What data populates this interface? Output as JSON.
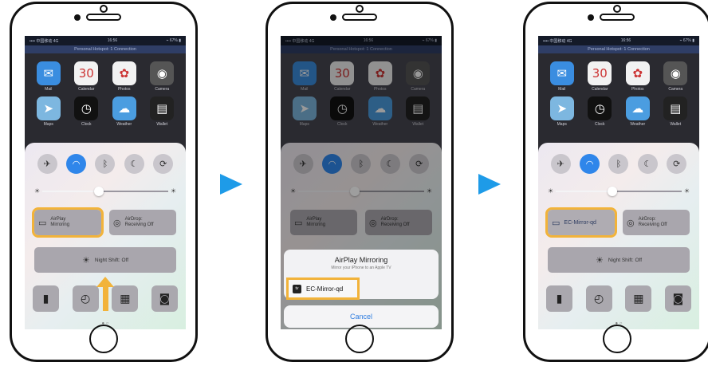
{
  "colors": {
    "highlight": "#f2b33a",
    "arrow": "#1e9be8",
    "toggle_on": "#2f86ea",
    "cancel_text": "#2f7de0"
  },
  "status_bar": {
    "left": "•••• 中国移动  4G",
    "time": "16:56",
    "right": "⌁ 67% ▮"
  },
  "banner": "Personal Hotspot: 1 Connection",
  "apps": [
    {
      "label": "Mail",
      "icon": "mail-icon",
      "glyph": "✉",
      "color": "#3a8de0"
    },
    {
      "label": "Calendar",
      "icon": "calendar-icon",
      "glyph": "30",
      "color": "#f2f2f2"
    },
    {
      "label": "Photos",
      "icon": "photos-icon",
      "glyph": "✿",
      "color": "#f2f2f2"
    },
    {
      "label": "Camera",
      "icon": "camera-icon",
      "glyph": "◉",
      "color": "#555"
    },
    {
      "label": "Maps",
      "icon": "maps-icon",
      "glyph": "➤",
      "color": "#7db7e0"
    },
    {
      "label": "Clock",
      "icon": "clock-icon",
      "glyph": "◷",
      "color": "#111"
    },
    {
      "label": "Weather",
      "icon": "weather-icon",
      "glyph": "☁",
      "color": "#4b9de0"
    },
    {
      "label": "Wallet",
      "icon": "wallet-icon",
      "glyph": "▤",
      "color": "#222"
    }
  ],
  "control_center": {
    "toggles": [
      {
        "icon": "airplane-icon",
        "glyph": "✈",
        "on": false
      },
      {
        "icon": "wifi-icon",
        "glyph": "◠",
        "on": true
      },
      {
        "icon": "bluetooth-icon",
        "glyph": "ᛒ",
        "on": false
      },
      {
        "icon": "moon-icon",
        "glyph": "☾",
        "on": false
      },
      {
        "icon": "rotation-lock-icon",
        "glyph": "⟳",
        "on": false
      }
    ],
    "brightness": 0.45,
    "airplay_label_line1": "AirPlay",
    "airplay_label_line2": "Mirroring",
    "airdrop_label_line1": "AirDrop:",
    "airdrop_label_line2": "Receiving Off",
    "airplay_selected_label": "EC-Mirror-qd",
    "night_shift_label": "Night Shift: Off",
    "shortcuts": [
      {
        "icon": "flashlight-icon",
        "glyph": "▮"
      },
      {
        "icon": "timer-icon",
        "glyph": "◴"
      },
      {
        "icon": "calculator-icon",
        "glyph": "▦"
      },
      {
        "icon": "camera-icon",
        "glyph": "◙"
      }
    ]
  },
  "sheet": {
    "title": "AirPlay Mirroring",
    "subtitle": "Mirror your iPhone to an Apple TV",
    "device_badge": "tv",
    "device_name": "EC-Mirror-qd",
    "cancel_label": "Cancel"
  }
}
